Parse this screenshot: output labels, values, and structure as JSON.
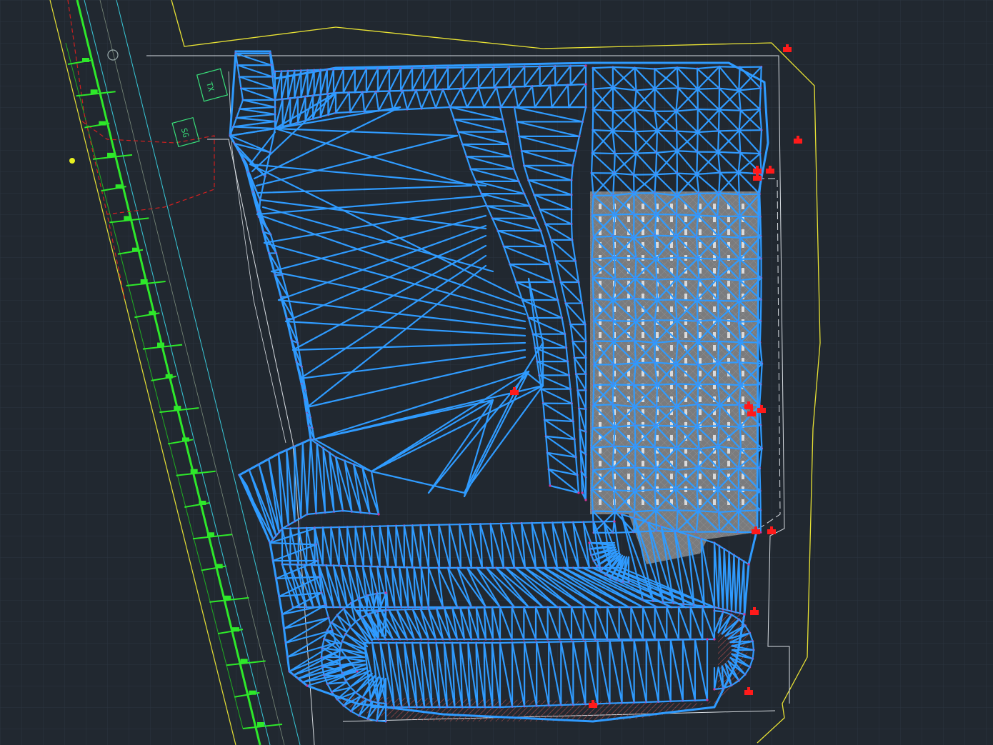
{
  "drawing": {
    "labels": {
      "transformer": "TX",
      "switchgear": "SG"
    },
    "colors": {
      "background": "#212830",
      "grid": "#2c3540",
      "mesh": "#2f9bff",
      "mesh_glow": "#1d6fd8",
      "vertex": "#d0349a",
      "boundary_yellow": "#e8e234",
      "boundary_white": "#d8dde2",
      "road_green": "#2ee82a",
      "utility_cyan": "#38c8d8",
      "fire_red": "#ff1a1a",
      "dashed_red": "#d02020",
      "parking_gray": "#8c8c8c"
    },
    "icons": [
      "tree-marker-icon",
      "hydrant-icon",
      "survey-point-icon"
    ]
  }
}
